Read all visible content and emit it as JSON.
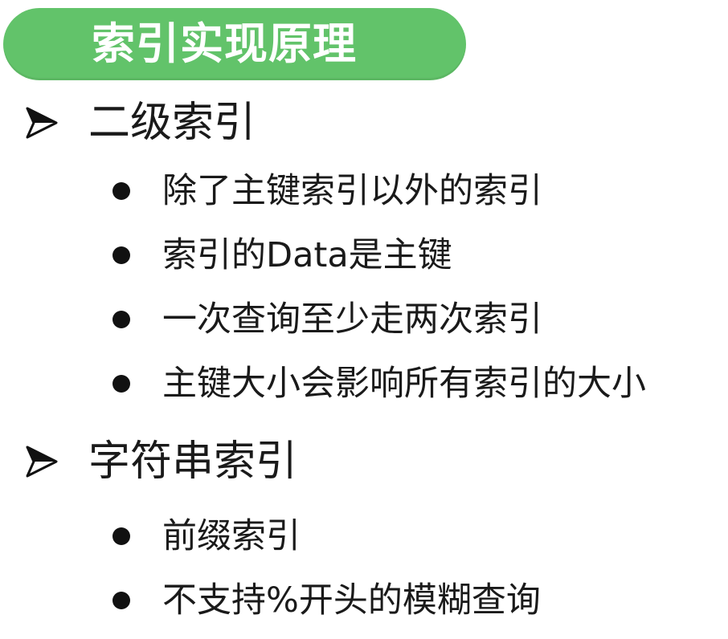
{
  "title": "索引实现原理",
  "sections": [
    {
      "label": "二级索引",
      "icon": "arrow-bullet-icon",
      "items": [
        "除了主键索引以外的索引",
        "索引的Data是主键",
        "一次查询至少走两次索引",
        "主键大小会影响所有索引的大小"
      ]
    },
    {
      "label": "字符串索引",
      "icon": "arrow-bullet-icon",
      "items": [
        "前缀索引",
        "不支持%开头的模糊查询"
      ]
    }
  ],
  "colors": {
    "title_pill": "#62c36a",
    "title_text": "#ffffff",
    "body_text": "#1a1a1a"
  }
}
